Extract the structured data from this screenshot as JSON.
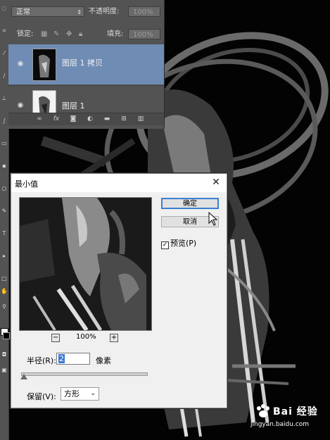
{
  "layers_panel": {
    "blend_mode": "正常",
    "opacity_label": "不透明度:",
    "opacity_value": "100%",
    "lock_label": "锁定:",
    "fill_label": "填充:",
    "fill_value": "100%",
    "layers": [
      {
        "name": "图层 1 拷贝",
        "selected": true,
        "visible": true
      },
      {
        "name": "图层 1",
        "selected": false,
        "visible": true
      }
    ]
  },
  "dialog": {
    "title": "最小值",
    "ok_label": "确定",
    "cancel_label": "取消",
    "preview_label": "预览(P)",
    "preview_checked": true,
    "zoom_value": "100%",
    "zoom_out": "−",
    "zoom_in": "+",
    "radius_label": "半径(R):",
    "radius_value": "2",
    "radius_unit": "像素",
    "preserve_label": "保留(V):",
    "preserve_value": "方形"
  },
  "watermark": {
    "brand": "Bai 经验",
    "url": "jingyan.baidu.com"
  },
  "colors": {
    "panel_bg": "#535353",
    "layer_selected": "#6f8cb5",
    "ok_border": "#3c7fd1"
  }
}
